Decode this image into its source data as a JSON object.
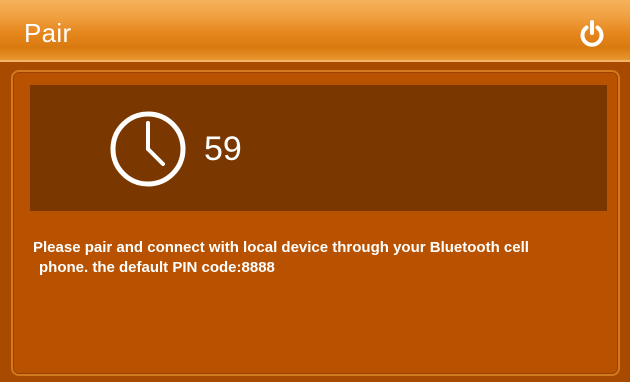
{
  "header": {
    "title": "Pair",
    "power_icon": "power-icon"
  },
  "timer": {
    "clock_icon": "clock-icon",
    "countdown": "59"
  },
  "message": {
    "line1": "Please pair and connect with local device through your Bluetooth cell",
    "line2": "phone. the default PIN code:8888"
  },
  "colors": {
    "header": "#e6861c",
    "panel": "#b85200",
    "timer_box": "#7a3800",
    "text": "#ffffff"
  }
}
